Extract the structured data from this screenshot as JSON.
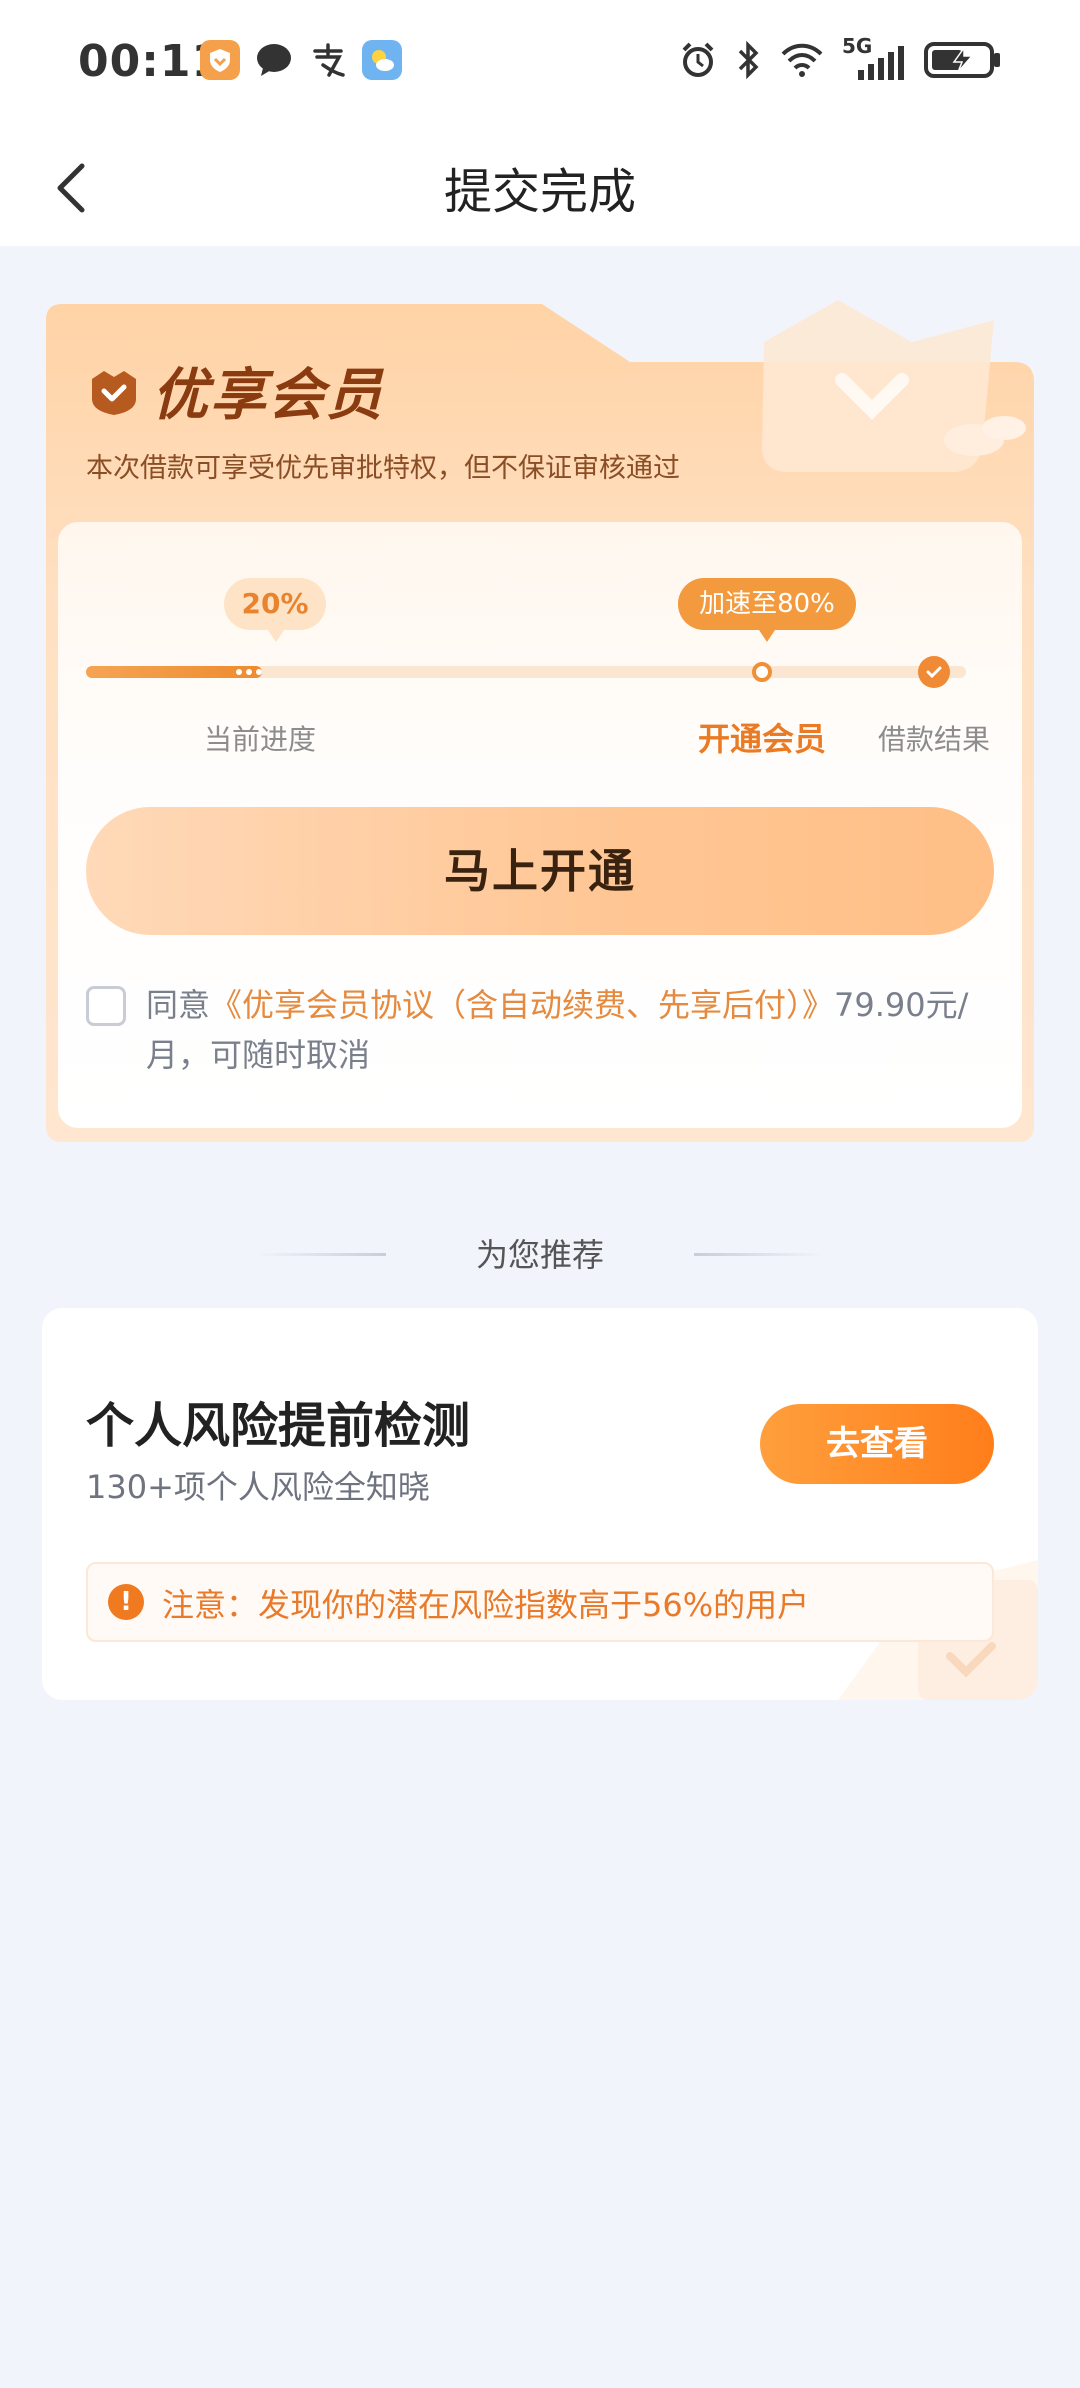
{
  "status_bar": {
    "time": "00:11",
    "app_icons": [
      "shield-app-icon",
      "message-icon",
      "alipay-icon",
      "weather-icon"
    ],
    "network": "5G"
  },
  "nav": {
    "title": "提交完成"
  },
  "vip": {
    "title": "优享会员",
    "subtitle": "本次借款可享受优先审批特权，但不保证审核通过",
    "progress_badge": "20%",
    "speedup_badge": "加速至80%",
    "progress_fraction": 0.2,
    "steps": [
      "当前进度",
      "开通会员",
      "借款结果"
    ],
    "cta": "马上开通",
    "agree_prefix": "同意",
    "agree_link": "《优享会员协议（含自动续费、先享后付）》",
    "agree_suffix": "79.90元/月，可随时取消"
  },
  "recommend": {
    "header": "为您推荐",
    "title": "个人风险提前检测",
    "subtitle": "130+项个人风险全知晓",
    "button": "去查看",
    "note": "注意：发现你的潜在风险指数高于56%的用户"
  },
  "colors": {
    "accent": "#f08a34",
    "brand_dark": "#8a3c10",
    "page_bg": "#f1f4fb"
  }
}
